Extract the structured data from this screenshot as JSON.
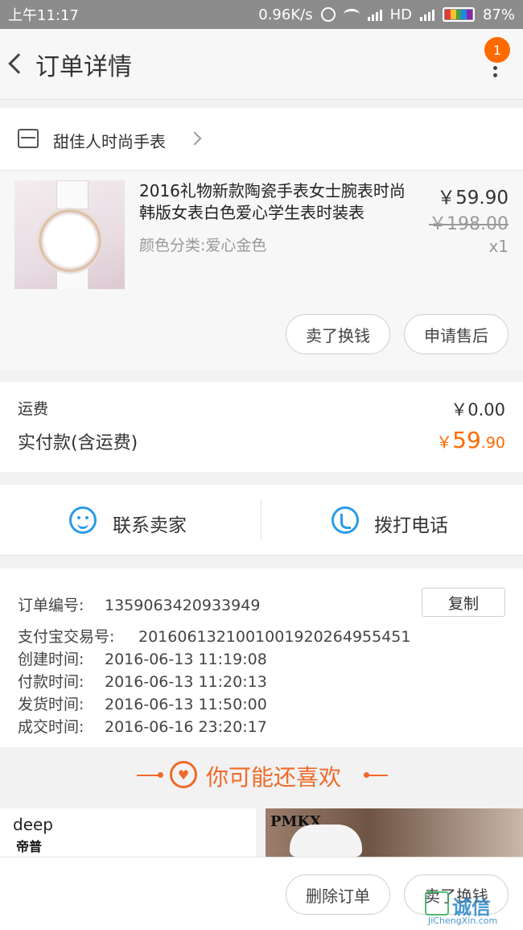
{
  "status_bar": {
    "time": "上午11:17",
    "speed": "0.96K/s",
    "network": "HD",
    "battery": "87%"
  },
  "nav": {
    "title": "订单详情",
    "badge": "1"
  },
  "shop": {
    "name": "甜佳人时尚手表"
  },
  "product": {
    "title": "2016礼物新款陶瓷手表女士腕表时尚韩版女表白色爱心学生表时装表",
    "sku": "颜色分类:爱心金色",
    "price": "￥59.90",
    "original_price": "￥198.00",
    "quantity": "x1",
    "sell_button": "卖了换钱",
    "after_sale_button": "申请售后"
  },
  "fees": {
    "shipping_label": "运费",
    "shipping_value": "￥0.00",
    "paid_label": "实付款(含运费)",
    "paid_currency": "￥",
    "paid_integer": "59",
    "paid_decimal": ".90"
  },
  "contact": {
    "seller_label": "联系卖家",
    "call_label": "拨打电话"
  },
  "order_info": {
    "order_no_label": "订单编号:",
    "order_no": "1359063420933949",
    "copy_button": "复制",
    "alipay_label": "支付宝交易号:",
    "alipay_no": "2016061321001001920264955451",
    "created_label": "创建时间:",
    "created": "2016-06-13 11:19:08",
    "paid_label": "付款时间:",
    "paid": "2016-06-13 11:20:13",
    "shipped_label": "发货时间:",
    "shipped": "2016-06-13 11:50:00",
    "completed_label": "成交时间:",
    "completed": "2016-06-16 23:20:17"
  },
  "recommend": {
    "title": "你可能还喜欢",
    "left_brand": "deep",
    "left_brand_cn": "帝普",
    "right_brand": "PMKX"
  },
  "bottom_bar": {
    "delete_button": "删除订单",
    "sell_button": "卖了换钱"
  },
  "watermark": {
    "text": "诚信",
    "url": "JiChengXin.com"
  },
  "colors": {
    "accent": "#ff6a00",
    "link_blue": "#2b9be8",
    "recommend": "#f06a2a"
  }
}
